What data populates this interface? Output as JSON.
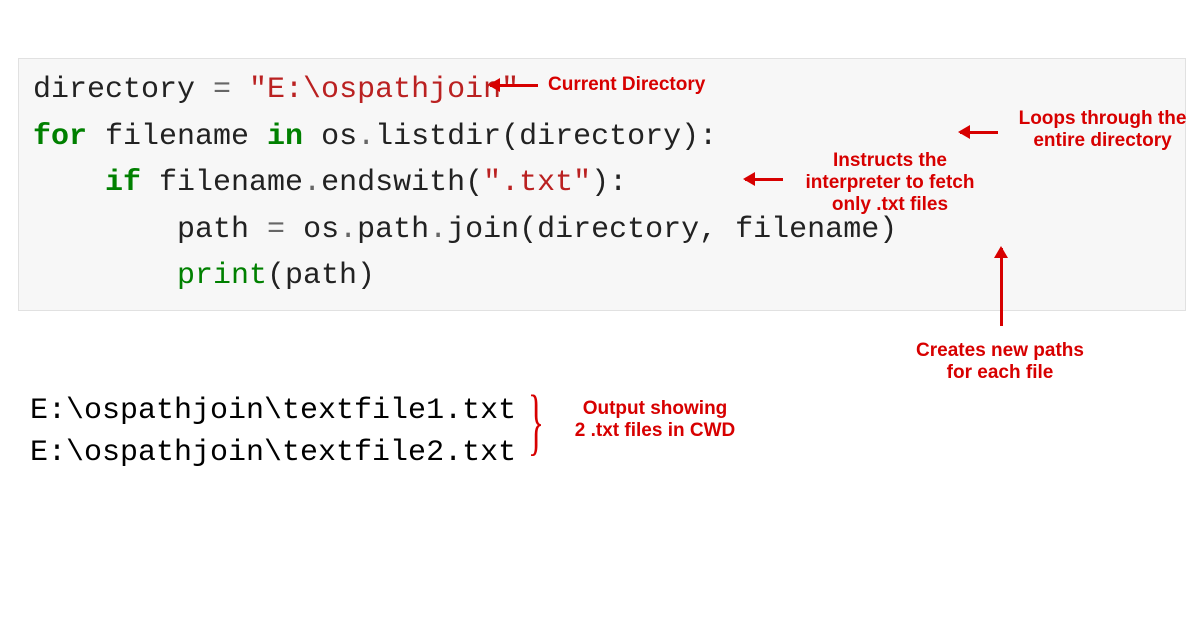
{
  "code": {
    "l1_var": "directory ",
    "l1_eq": "=",
    "l1_str": " \"E:\\ospathjoin\"",
    "l2_for": "for",
    "l2_mid": " filename ",
    "l2_in": "in",
    "l2_tail": " os",
    "l2_dot1": ".",
    "l2_listdir": "listdir(directory):",
    "l3_indent": "    ",
    "l3_if": "if",
    "l3_mid": " filename",
    "l3_dot": ".",
    "l3_ends": "endswith(",
    "l3_str": "\".txt\"",
    "l3_close": "):",
    "l4_indent": "        ",
    "l4_path": "path ",
    "l4_eq": "=",
    "l4_mid": " os",
    "l4_dot1": ".",
    "l4_p1": "path",
    "l4_dot2": ".",
    "l4_join": "join(directory, filename)",
    "l5_indent": "        ",
    "l5_print": "print",
    "l5_args": "(path)"
  },
  "output": {
    "line1": "E:\\ospathjoin\\textfile1.txt",
    "line2": "E:\\ospathjoin\\textfile2.txt"
  },
  "annot": {
    "a1": "Current Directory",
    "a2": "Loops through the\nentire directory",
    "a3": "Instructs the\ninterpreter to fetch\nonly .txt files",
    "a4": "Creates new paths\nfor each file",
    "a5": "Output showing\n2 .txt files in CWD"
  },
  "colors": {
    "annotation": "#d70000",
    "keyword": "#008000",
    "string": "#BA2121",
    "operator": "#666666"
  }
}
